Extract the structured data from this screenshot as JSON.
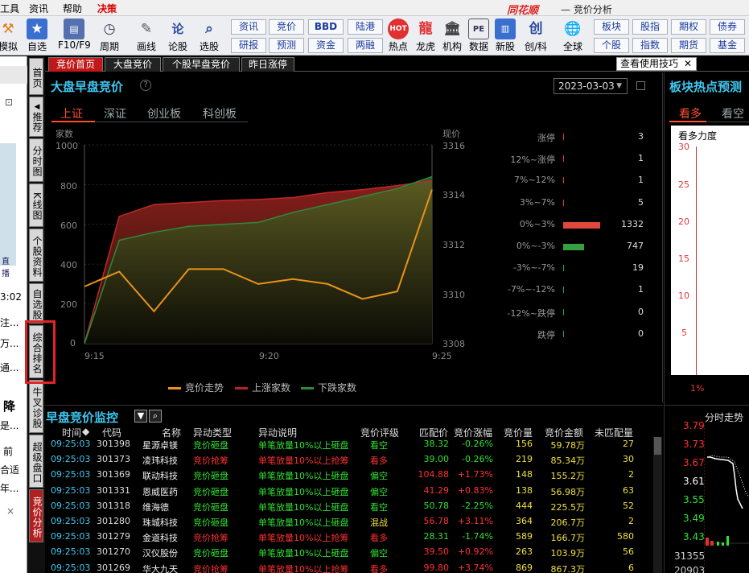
{
  "menu": {
    "items": [
      "工具",
      "资讯",
      "帮助",
      "决策"
    ],
    "brand": "同花顺",
    "title": "竞价分析"
  },
  "toolbar": {
    "icons": [
      {
        "label": "模拟",
        "icon": "hammer-icon"
      },
      {
        "label": "自选",
        "icon": "star-icon"
      },
      {
        "label": "F10/F9",
        "icon": "f10-icon"
      },
      {
        "label": "周期",
        "icon": "clock-icon"
      },
      {
        "label": "画线",
        "icon": "pencil-icon"
      },
      {
        "label": "论股",
        "icon": "discuss-icon"
      },
      {
        "label": "选股",
        "icon": "select-stock-icon"
      }
    ],
    "buttons": [
      [
        "资讯",
        "竞价",
        "BBD",
        "陆港"
      ],
      [
        "研报",
        "预测",
        "资金",
        "两融"
      ]
    ],
    "icons2": [
      {
        "label": "热点",
        "icon": "hot-icon"
      },
      {
        "label": "龙虎",
        "icon": "dragon-icon"
      },
      {
        "label": "机构",
        "icon": "bank-icon"
      },
      {
        "label": "数据",
        "icon": "pe-icon"
      },
      {
        "label": "新股",
        "icon": "newstock-icon"
      },
      {
        "label": "创/科",
        "icon": "chuang-icon"
      },
      {
        "label": "全球",
        "icon": "globe-icon"
      }
    ],
    "buttons2": [
      [
        "板块",
        "股指",
        "期权",
        "债券"
      ],
      [
        "个股",
        "指数",
        "期货",
        "基金"
      ]
    ]
  },
  "left_panel": {
    "time": "3:02",
    "snippets": [
      "注...",
      "万...",
      "通...",
      "降",
      "是...",
      "前",
      "合适",
      "年...",
      "×"
    ],
    "icon_label": "直播"
  },
  "side_tabs": [
    "首页",
    "推荐",
    "分时图",
    "K线图",
    "个股资料",
    "自选股",
    "综合排名",
    "牛叉诊股",
    "超级盘口",
    "竞价分析"
  ],
  "content_tabs": [
    "竞价首页",
    "大盘竞价",
    "个股早盘竞价",
    "昨日涨停"
  ],
  "tip_button": "查看使用技巧",
  "main": {
    "title": "大盘早盘竞价",
    "date": "2023-03-03",
    "subtabs": [
      "上证",
      "深证",
      "创业板",
      "科创板"
    ],
    "left_axis_title": "家数",
    "right_axis_title": "现价",
    "left_ticks": [
      "1000",
      "800",
      "600",
      "400",
      "200",
      "0"
    ],
    "right_ticks": [
      "3316",
      "3314",
      "3312",
      "3310",
      "3308"
    ],
    "time_ticks": [
      "9:15",
      "9:20",
      "9:25"
    ],
    "legend": [
      "竞价走势",
      "上涨家数",
      "下跌家数"
    ]
  },
  "chart_data": {
    "type": "area",
    "title": "大盘早盘竞价",
    "x": [
      "9:15",
      "9:16",
      "9:17",
      "9:18",
      "9:19",
      "9:20",
      "9:21",
      "9:22",
      "9:23",
      "9:24",
      "9:25"
    ],
    "series": [
      {
        "name": "上涨家数",
        "values": [
          0,
          640,
          700,
          710,
          720,
          725,
          735,
          760,
          775,
          795,
          820
        ]
      },
      {
        "name": "下跌家数",
        "values": [
          0,
          520,
          560,
          590,
          600,
          610,
          660,
          700,
          740,
          780,
          840
        ]
      },
      {
        "name": "竞价走势",
        "values": [
          3310.3,
          3310.9,
          3309.3,
          3311.0,
          3311.0,
          3310.4,
          3310.6,
          3310.4,
          3309.8,
          3310.1,
          3314.2
        ]
      }
    ],
    "ylim_left": [
      0,
      1000
    ],
    "ylim_right": [
      3308,
      3316
    ],
    "distribution": [
      {
        "label": "涨停",
        "value": 3
      },
      {
        "label": "12%~涨停",
        "value": 1
      },
      {
        "label": "7%~12%",
        "value": 1
      },
      {
        "label": "3%~7%",
        "value": 5
      },
      {
        "label": "0%~3%",
        "value": 1332
      },
      {
        "label": "0%~-3%",
        "value": 747
      },
      {
        "label": "-3%~-7%",
        "value": 19
      },
      {
        "label": "-7%~-12%",
        "value": 1
      },
      {
        "label": "-12%~跌停",
        "value": 0
      },
      {
        "label": "跌停",
        "value": 0
      }
    ]
  },
  "monitor": {
    "title": "早盘竞价监控",
    "columns": [
      "时间",
      "代码",
      "名称",
      "异动类型",
      "异动说明",
      "竞价评级",
      "匹配价",
      "竞价涨幅",
      "竞价量",
      "竞价金额",
      "未匹配量"
    ],
    "rows": [
      [
        "09:25:03",
        "301398",
        "星源卓镁",
        "竞价砸盘",
        "单笔放量10%以上砸盘",
        "看空",
        "38.32",
        "-0.26%",
        "156",
        "59.78万",
        "27"
      ],
      [
        "09:25:03",
        "301373",
        "凌玮科技",
        "竞价抢筹",
        "单笔放量10%以上抢筹",
        "看多",
        "39.00",
        "-0.26%",
        "219",
        "85.34万",
        "30"
      ],
      [
        "09:25:03",
        "301369",
        "联动科技",
        "竞价砸盘",
        "单笔放量10%以上砸盘",
        "偏空",
        "104.88",
        "+1.73%",
        "148",
        "155.2万",
        "2"
      ],
      [
        "09:25:03",
        "301331",
        "恩威医药",
        "竞价砸盘",
        "单笔放量10%以上砸盘",
        "偏空",
        "41.29",
        "+0.83%",
        "138",
        "56.98万",
        "63"
      ],
      [
        "09:25:03",
        "301318",
        "维海德",
        "竞价砸盘",
        "单笔放量10%以上砸盘",
        "看空",
        "50.78",
        "-2.25%",
        "444",
        "225.5万",
        "52"
      ],
      [
        "09:25:03",
        "301280",
        "珠城科技",
        "竞价砸盘",
        "单笔放量10%以上砸盘",
        "混战",
        "56.78",
        "+3.11%",
        "364",
        "206.7万",
        "2"
      ],
      [
        "09:25:03",
        "301279",
        "金道科技",
        "竞价抢筹",
        "单笔放量10%以上抢筹",
        "看多",
        "28.31",
        "-1.74%",
        "589",
        "166.7万",
        "580"
      ],
      [
        "09:25:03",
        "301270",
        "汉仪股份",
        "竞价砸盘",
        "单笔放量10%以上砸盘",
        "偏空",
        "39.50",
        "+0.92%",
        "263",
        "103.9万",
        "56"
      ],
      [
        "09:25:03",
        "301269",
        "华大九天",
        "竞价抢筹",
        "单笔放量10%以上抢筹",
        "看多",
        "99.80",
        "+3.74%",
        "869",
        "867.3万",
        "6"
      ]
    ]
  },
  "right": {
    "title": "板块热点预测",
    "subtabs": [
      "看多",
      "看空"
    ],
    "strength_label": "看多力度",
    "ticks": [
      "30",
      "25",
      "20",
      "15",
      "10",
      "5",
      "1%"
    ],
    "intraday_title": "分时走势",
    "price_ticks": [
      "3.79",
      "3.73",
      "3.67",
      "3.61",
      "3.55",
      "3.49",
      "3.43"
    ],
    "vol_ticks": [
      "31355",
      "20903"
    ]
  },
  "colors": {
    "up": "#ff3030",
    "down": "#30e030",
    "accent": "#3fc8f0",
    "rise_fill": "#7a1a18",
    "fall_fill": "#1e5a24",
    "trend": "#e8921a"
  }
}
